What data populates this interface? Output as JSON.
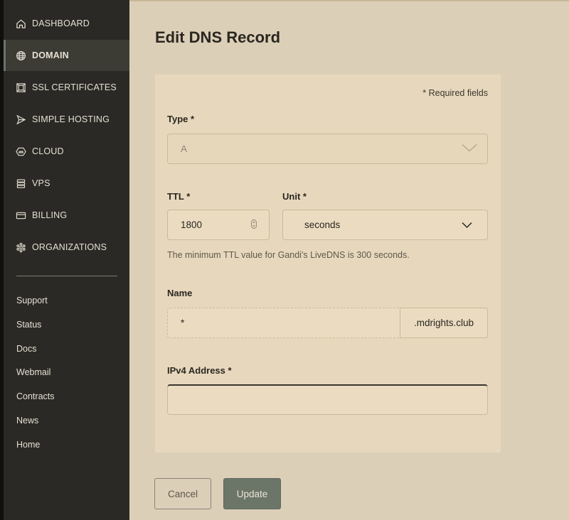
{
  "sidebar": {
    "items": [
      {
        "label": "DASHBOARD",
        "icon": "home-icon"
      },
      {
        "label": "DOMAIN",
        "icon": "globe-icon"
      },
      {
        "label": "SSL CERTIFICATES",
        "icon": "certificate-icon"
      },
      {
        "label": "SIMPLE HOSTING",
        "icon": "paper-plane-icon"
      },
      {
        "label": "CLOUD",
        "icon": "cloud-hexagon-icon"
      },
      {
        "label": "VPS",
        "icon": "server-stack-icon"
      },
      {
        "label": "BILLING",
        "icon": "credit-card-icon"
      },
      {
        "label": "ORGANIZATIONS",
        "icon": "organization-icon"
      }
    ],
    "active_index": 1,
    "footer_links": [
      "Support",
      "Status",
      "Docs",
      "Webmail",
      "Contracts",
      "News",
      "Home"
    ]
  },
  "page": {
    "title": "Edit DNS Record"
  },
  "form": {
    "required_note": "* Required fields",
    "type": {
      "label": "Type *",
      "value": "A"
    },
    "ttl": {
      "label": "TTL *",
      "value": "1800"
    },
    "unit": {
      "label": "Unit *",
      "value": "seconds"
    },
    "help_text": "The minimum TTL value for Gandi's LiveDNS is 300 seconds.",
    "name": {
      "label": "Name",
      "value": "*",
      "suffix": ".mdrights.club"
    },
    "ipv4": {
      "label": "IPv4 Address *",
      "value": ""
    }
  },
  "actions": {
    "cancel_label": "Cancel",
    "update_label": "Update"
  },
  "colors": {
    "sidebar_bg": "#2a2925",
    "page_bg": "#dccfb8",
    "card_bg": "#e7d8bd",
    "update_button": "#6b7568"
  }
}
